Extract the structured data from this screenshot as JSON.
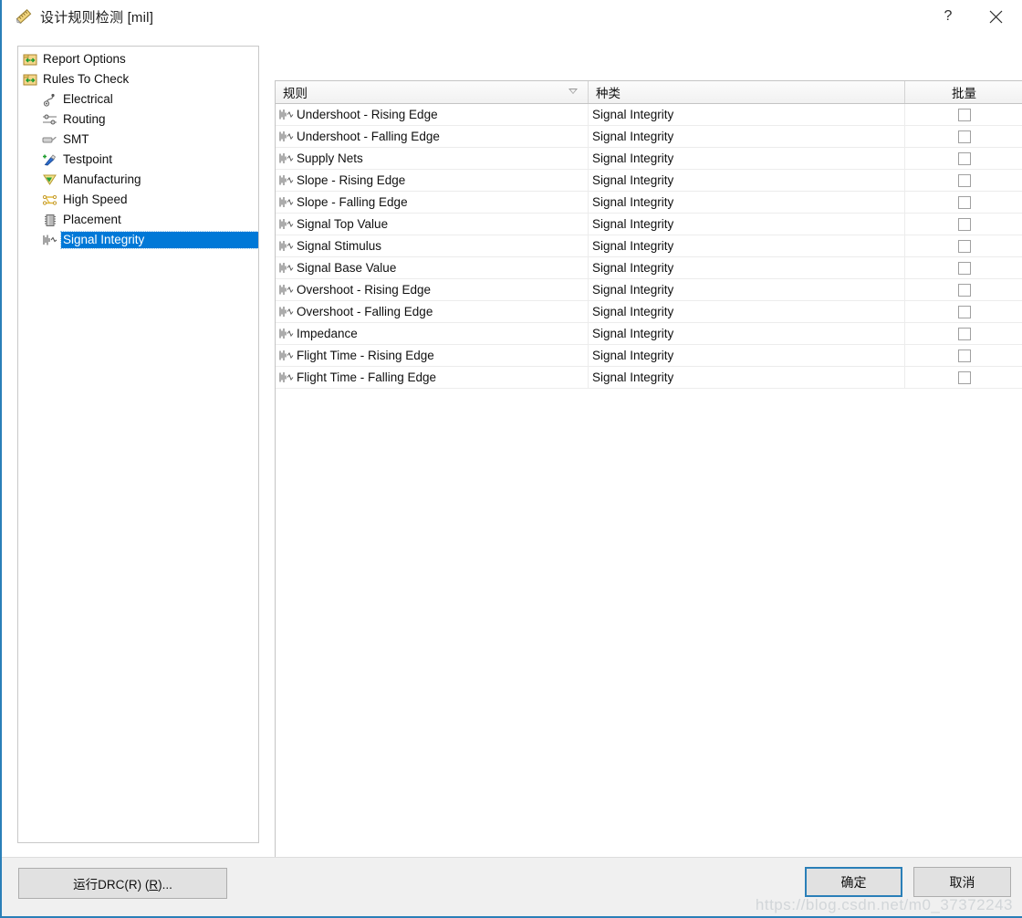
{
  "window": {
    "title": "设计规则检测 [mil]",
    "title_icon": "ruler-pencil-icon",
    "help_label": "?",
    "close_label": "×",
    "accent_color": "#2a7fb8",
    "selection_color": "#0078d7"
  },
  "tree": {
    "items": [
      {
        "label": "Report Options",
        "icon": "report-options-icon",
        "level": 0,
        "selected": false
      },
      {
        "label": "Rules To Check",
        "icon": "rules-to-check-icon",
        "level": 0,
        "selected": false
      },
      {
        "label": "Electrical",
        "icon": "electrical-icon",
        "level": 1,
        "selected": false
      },
      {
        "label": "Routing",
        "icon": "routing-icon",
        "level": 1,
        "selected": false
      },
      {
        "label": "SMT",
        "icon": "smt-icon",
        "level": 1,
        "selected": false
      },
      {
        "label": "Testpoint",
        "icon": "testpoint-icon",
        "level": 1,
        "selected": false
      },
      {
        "label": "Manufacturing",
        "icon": "manufacturing-icon",
        "level": 1,
        "selected": false
      },
      {
        "label": "High Speed",
        "icon": "high-speed-icon",
        "level": 1,
        "selected": false
      },
      {
        "label": "Placement",
        "icon": "placement-icon",
        "level": 1,
        "selected": false
      },
      {
        "label": "Signal Integrity",
        "icon": "signal-integrity-icon",
        "level": 1,
        "selected": true
      }
    ]
  },
  "table": {
    "columns": [
      {
        "label": "规则",
        "sort": "descending"
      },
      {
        "label": "种类",
        "sort": "none"
      },
      {
        "label": "批量",
        "sort": "none"
      }
    ],
    "rows": [
      {
        "rule": "Undershoot - Rising Edge",
        "category": "Signal Integrity",
        "batch_checked": false,
        "icon": "signal-waveform-icon"
      },
      {
        "rule": "Undershoot - Falling Edge",
        "category": "Signal Integrity",
        "batch_checked": false,
        "icon": "signal-waveform-icon"
      },
      {
        "rule": "Supply Nets",
        "category": "Signal Integrity",
        "batch_checked": false,
        "icon": "signal-waveform-icon"
      },
      {
        "rule": "Slope - Rising Edge",
        "category": "Signal Integrity",
        "batch_checked": false,
        "icon": "signal-waveform-icon"
      },
      {
        "rule": "Slope - Falling Edge",
        "category": "Signal Integrity",
        "batch_checked": false,
        "icon": "signal-waveform-icon"
      },
      {
        "rule": "Signal Top Value",
        "category": "Signal Integrity",
        "batch_checked": false,
        "icon": "signal-waveform-icon"
      },
      {
        "rule": "Signal Stimulus",
        "category": "Signal Integrity",
        "batch_checked": false,
        "icon": "signal-waveform-icon"
      },
      {
        "rule": "Signal Base Value",
        "category": "Signal Integrity",
        "batch_checked": false,
        "icon": "signal-waveform-icon"
      },
      {
        "rule": "Overshoot - Rising Edge",
        "category": "Signal Integrity",
        "batch_checked": false,
        "icon": "signal-waveform-icon"
      },
      {
        "rule": "Overshoot - Falling Edge",
        "category": "Signal Integrity",
        "batch_checked": false,
        "icon": "signal-waveform-icon"
      },
      {
        "rule": "Impedance",
        "category": "Signal Integrity",
        "batch_checked": false,
        "icon": "signal-waveform-icon"
      },
      {
        "rule": "Flight Time - Rising Edge",
        "category": "Signal Integrity",
        "batch_checked": false,
        "icon": "signal-waveform-icon"
      },
      {
        "rule": "Flight Time - Falling Edge",
        "category": "Signal Integrity",
        "batch_checked": false,
        "icon": "signal-waveform-icon"
      }
    ]
  },
  "footer": {
    "run_drc_prefix": "运行DRC(R) (",
    "run_drc_key": "R",
    "run_drc_suffix": ")...",
    "ok_label": "确定",
    "cancel_label": "取消",
    "watermark": "https://blog.csdn.net/m0_37372243"
  }
}
